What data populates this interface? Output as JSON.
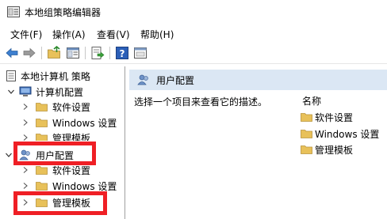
{
  "window": {
    "title": "本地组策略编辑器"
  },
  "menu": [
    {
      "label": "文件(F)"
    },
    {
      "label": "操作(A)"
    },
    {
      "label": "查看(V)"
    },
    {
      "label": "帮助(H)"
    }
  ],
  "toolbar": {
    "buttons": [
      "back-icon",
      "forward-icon",
      "up-folder-icon",
      "show-hide-tree-icon",
      "export-list-icon",
      "help-icon",
      "properties-icon"
    ]
  },
  "tree": {
    "root": "本地计算机 策略",
    "computer_config": "计算机配置",
    "computer_children": [
      "软件设置",
      "Windows 设置",
      "管理模板"
    ],
    "user_config": "用户配置",
    "user_children": [
      "软件设置",
      "Windows 设置",
      "管理模板"
    ]
  },
  "right": {
    "header": "用户配置",
    "description": "选择一个项目来查看它的描述。",
    "column_name": "名称",
    "items": [
      "软件设置",
      "Windows 设置",
      "管理模板"
    ]
  },
  "colors": {
    "highlight": "#ef1f25",
    "folder": "#e8c15a",
    "header_bg": "#dbe7f4"
  }
}
